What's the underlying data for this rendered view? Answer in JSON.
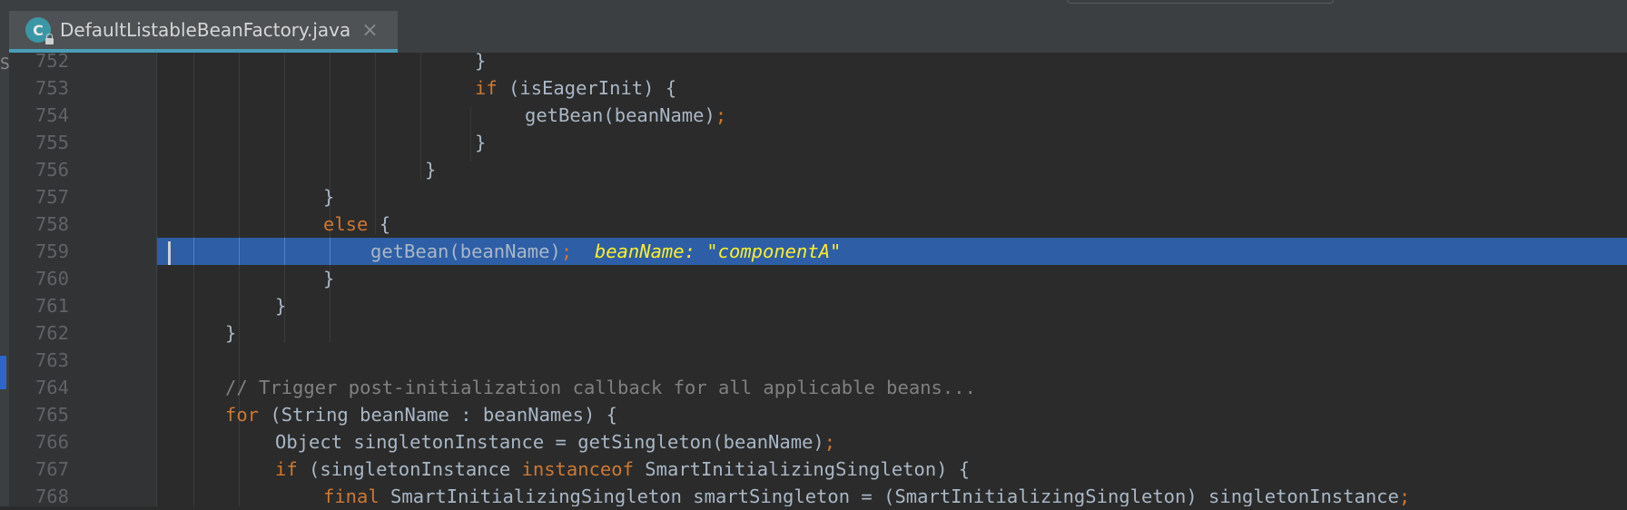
{
  "editor_tab": {
    "title": "DefaultListableBeanFactory.java",
    "icon_letter": "C",
    "close_glyph": "×"
  },
  "left_strip": {
    "glyph": "S"
  },
  "colors": {
    "keyword": "#cc7832",
    "default_text": "#a9b7c6",
    "comment": "#808080",
    "debug_value": "#ffef28",
    "current_line": "#2d5ea6"
  },
  "lines": [
    {
      "number": "752",
      "tokens": [
        {
          "t": "}",
          "c": "tx"
        }
      ]
    },
    {
      "number": "753",
      "tokens": [
        {
          "t": "if",
          "c": "kw"
        },
        {
          "t": " (isEagerInit) {",
          "c": "tx"
        }
      ]
    },
    {
      "number": "754",
      "tokens": [
        {
          "t": "getBean(beanName)",
          "c": "tx"
        },
        {
          "t": ";",
          "c": "punct"
        }
      ]
    },
    {
      "number": "755",
      "tokens": [
        {
          "t": "}",
          "c": "tx"
        }
      ]
    },
    {
      "number": "756",
      "tokens": [
        {
          "t": "}",
          "c": "tx"
        }
      ]
    },
    {
      "number": "757",
      "tokens": [
        {
          "t": "}",
          "c": "tx"
        }
      ]
    },
    {
      "number": "758",
      "tokens": [
        {
          "t": "else",
          "c": "kw"
        },
        {
          "t": " {",
          "c": "tx"
        }
      ]
    },
    {
      "number": "759",
      "tokens": [
        {
          "t": "getBean(beanName)",
          "c": "tx"
        },
        {
          "t": ";",
          "c": "punct"
        },
        {
          "t": "  beanName: \"componentA\"",
          "c": "dbg"
        }
      ]
    },
    {
      "number": "760",
      "tokens": [
        {
          "t": "}",
          "c": "tx"
        }
      ]
    },
    {
      "number": "761",
      "tokens": [
        {
          "t": "}",
          "c": "tx"
        }
      ]
    },
    {
      "number": "762",
      "tokens": [
        {
          "t": "}",
          "c": "tx"
        }
      ]
    },
    {
      "number": "763",
      "tokens": []
    },
    {
      "number": "764",
      "tokens": [
        {
          "t": "// Trigger post-initialization callback for all applicable beans...",
          "c": "cm"
        }
      ]
    },
    {
      "number": "765",
      "tokens": [
        {
          "t": "for",
          "c": "kw"
        },
        {
          "t": " (String beanName : beanNames) {",
          "c": "tx"
        }
      ]
    },
    {
      "number": "766",
      "tokens": [
        {
          "t": "Object singletonInstance = getSingleton(beanName)",
          "c": "tx"
        },
        {
          "t": ";",
          "c": "punct"
        }
      ]
    },
    {
      "number": "767",
      "tokens": [
        {
          "t": "if",
          "c": "kw"
        },
        {
          "t": " (singletonInstance ",
          "c": "tx"
        },
        {
          "t": "instanceof",
          "c": "kw"
        },
        {
          "t": " SmartInitializingSingleton) {",
          "c": "tx"
        }
      ]
    },
    {
      "number": "768",
      "tokens": [
        {
          "t": "final",
          "c": "kw"
        },
        {
          "t": " SmartInitializingSingleton smartSingleton = (SmartInitializingSingleton) singletonInstance",
          "c": "tx"
        },
        {
          "t": ";",
          "c": "punct"
        }
      ]
    }
  ]
}
